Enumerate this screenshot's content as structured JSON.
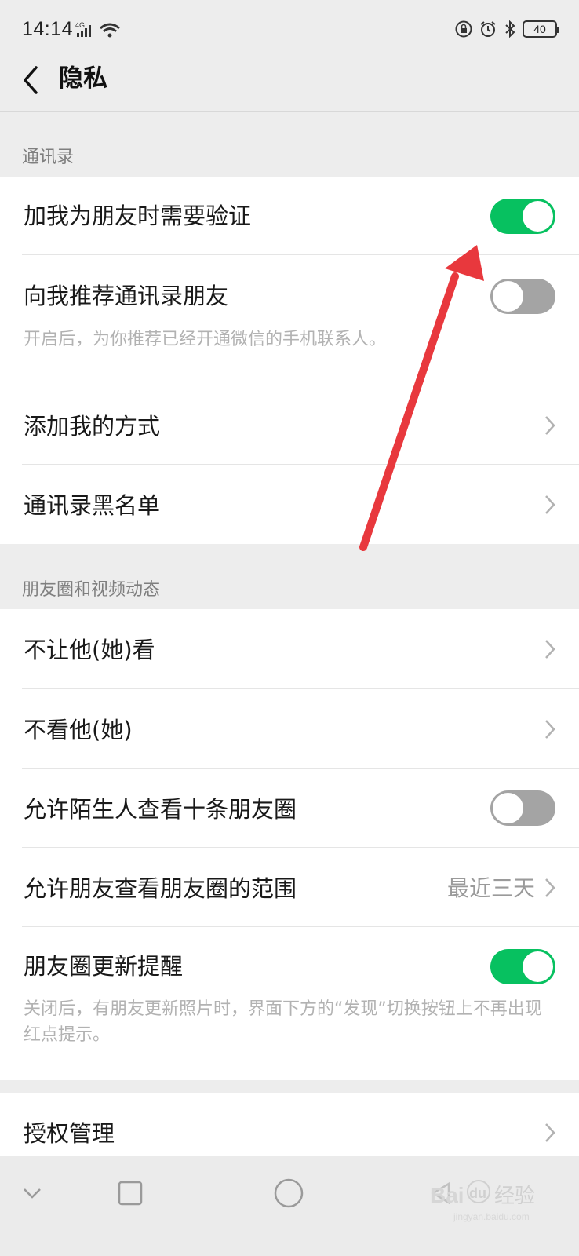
{
  "status_bar": {
    "time": "14:14",
    "network": "4G",
    "battery": "40"
  },
  "nav": {
    "title": "隐私"
  },
  "sections": {
    "contacts": {
      "label": "通讯录",
      "items": {
        "verify": {
          "label": "加我为朋友时需要验证",
          "toggle": true
        },
        "recommend": {
          "label": "向我推荐通讯录朋友",
          "toggle": false,
          "subtext": "开启后，为你推荐已经开通微信的手机联系人。"
        },
        "add_methods": {
          "label": "添加我的方式"
        },
        "blacklist": {
          "label": "通讯录黑名单"
        }
      }
    },
    "moments": {
      "label": "朋友圈和视频动态",
      "items": {
        "hide_from": {
          "label": "不让他(她)看"
        },
        "hide_theirs": {
          "label": "不看他(她)"
        },
        "strangers": {
          "label": "允许陌生人查看十条朋友圈",
          "toggle": false
        },
        "range": {
          "label": "允许朋友查看朋友圈的范围",
          "value": "最近三天"
        },
        "update_alert": {
          "label": "朋友圈更新提醒",
          "toggle": true,
          "subtext": "关闭后，有朋友更新照片时，界面下方的“发现”切换按钮上不再出现红点提示。"
        }
      }
    },
    "auth": {
      "items": {
        "auth_manage": {
          "label": "授权管理"
        }
      }
    }
  },
  "colors": {
    "toggle_on": "#07c160",
    "toggle_off": "#a4a4a4",
    "annotation_arrow": "#e8383d",
    "background": "#ededed"
  },
  "watermark": "Baidu经验 jingyan.baidu.com"
}
